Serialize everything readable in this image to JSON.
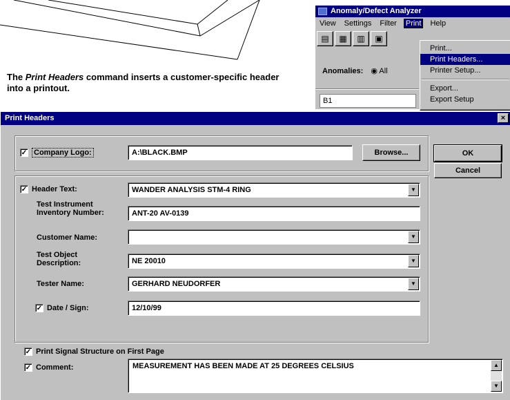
{
  "caption": {
    "part1": "The ",
    "italic": "Print Headers",
    "part2": " command inserts a customer-specific header into a printout."
  },
  "background_window": {
    "title": "Anomaly/Defect Analyzer",
    "menu": [
      "View",
      "Settings",
      "Filter",
      "Print",
      "Help"
    ],
    "active_menu": "Print",
    "print_menu_items": [
      "Print...",
      "Print Headers...",
      "Printer Setup...",
      "Export...",
      "Export Setup"
    ],
    "selected_item": "Print Headers...",
    "anomalies_label": "Anomalies:",
    "anomalies_option": "All",
    "cell_value": "B1"
  },
  "dialog": {
    "title": "Print Headers",
    "close_glyph": "×",
    "company_logo": {
      "label": "Company Logo:",
      "checked": true,
      "value": "A:\\BLACK.BMP",
      "browse_label": "Browse..."
    },
    "header_text": {
      "label": "Header Text:",
      "checked": true,
      "value": "WANDER ANALYSIS STM-4 RING"
    },
    "test_instrument": {
      "label": "Test Instrument Inventory Number:",
      "value": "ANT-20 AV-0139"
    },
    "customer_name": {
      "label": "Customer Name:",
      "value": ""
    },
    "test_object": {
      "label": "Test Object Description:",
      "value": "NE 20010"
    },
    "tester_name": {
      "label": "Tester Name:",
      "value": "GERHARD NEUDORFER"
    },
    "date_sign": {
      "label": "Date / Sign:",
      "checked": true,
      "value": "12/10/99"
    },
    "print_signal": {
      "label": "Print Signal Structure on First Page",
      "checked": true
    },
    "comment": {
      "label": "Comment:",
      "checked": true,
      "value": "MEASUREMENT HAS BEEN MADE AT 25 DEGREES CELSIUS"
    },
    "ok_label": "OK",
    "cancel_label": "Cancel",
    "check_glyph": "✓",
    "dropdown_glyph": "▼",
    "scroll_up_glyph": "▲",
    "scroll_down_glyph": "▼"
  }
}
